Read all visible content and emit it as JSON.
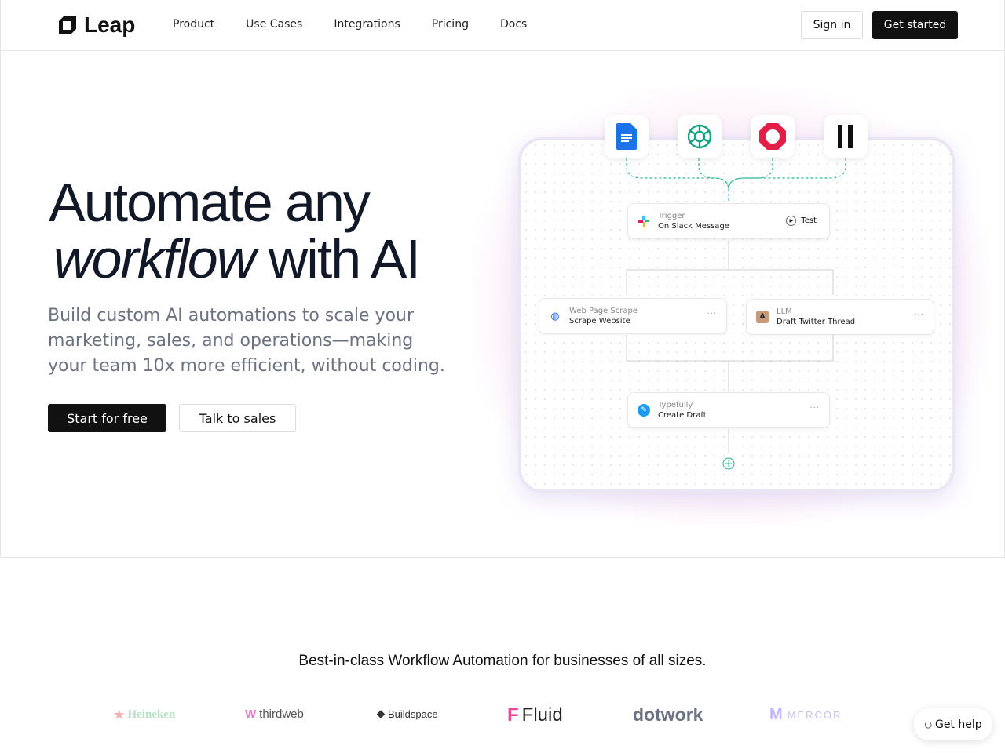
{
  "nav": {
    "brand": "Leap",
    "links": [
      "Product",
      "Use Cases",
      "Integrations",
      "Pricing",
      "Docs"
    ],
    "sign_in": "Sign in",
    "get_started": "Get started"
  },
  "hero": {
    "title_line1": "Automate any",
    "title_italic": "workflow",
    "title_rest": "with AI",
    "subtitle": "Build custom AI automations to scale your marketing, sales, and operations—making your team 10x more efficient, without coding.",
    "cta_primary": "Start for free",
    "cta_secondary": "Talk to sales"
  },
  "diagram": {
    "integrations": [
      "google-docs-icon",
      "openai-icon",
      "octagon-app-icon",
      "pause-bars-icon"
    ],
    "trigger": {
      "type": "Trigger",
      "name": "On Slack Message",
      "action": "Test"
    },
    "nodes": [
      {
        "type": "Web Page Scrape",
        "name": "Scrape Website"
      },
      {
        "type": "LLM",
        "name": "Draft Twitter Thread"
      },
      {
        "type": "Typefully",
        "name": "Create Draft"
      }
    ],
    "more": "···",
    "accent": "#2bb596"
  },
  "tagline": "Best-in-class Workflow Automation for businesses of all sizes.",
  "customers": [
    "Heineken",
    "thirdweb",
    "Buildspace",
    "Fluid",
    "dotwork",
    "MERCOR"
  ],
  "help": "Get help"
}
